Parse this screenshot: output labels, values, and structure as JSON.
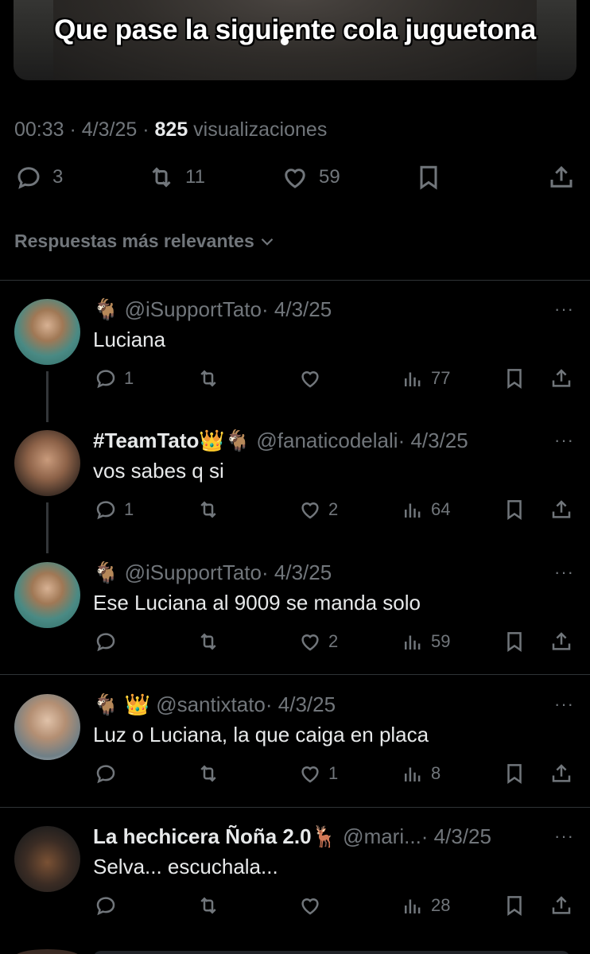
{
  "media": {
    "caption": "Que pase la siguiente cola juguetona"
  },
  "tweet_meta": {
    "time": "00:33",
    "sep1": " · ",
    "date": "4/3/25",
    "sep2": " · ",
    "views_count": "825",
    "views_label": " visualizaciones"
  },
  "tweet_actions": {
    "replies": "3",
    "retweets": "11",
    "likes": "59"
  },
  "sort_label": "Respuestas más relevantes",
  "replies": [
    {
      "emoji": "🐐",
      "name": "",
      "handle": "@iSupportTato",
      "date": "· 4/3/25",
      "text": "Luciana",
      "replies": "1",
      "retweets": "",
      "likes": "",
      "views": "77"
    },
    {
      "emoji": "👑🐐",
      "name": "#TeamTato",
      "handle": "@fanaticodelali",
      "date": "· 4/3/25",
      "text": "vos sabes q si",
      "replies": "1",
      "retweets": "",
      "likes": "2",
      "views": "64"
    },
    {
      "emoji": "🐐",
      "name": "",
      "handle": "@iSupportTato",
      "date": "· 4/3/25",
      "text": "Ese Luciana al 9009 se manda solo",
      "replies": "",
      "retweets": "",
      "likes": "2",
      "views": "59"
    },
    {
      "emoji": "🐐 👑",
      "name": "",
      "handle": "@santixtato",
      "date": "· 4/3/25",
      "text": "Luz o Luciana, la que caiga en placa",
      "replies": "",
      "retweets": "",
      "likes": "1",
      "views": "8"
    },
    {
      "emoji": "🦌",
      "name": "La hechicera Ñoña 2.0",
      "handle": "@mari...",
      "date": "· 4/3/25",
      "text": "Selva... escuchala...",
      "replies": "",
      "retweets": "",
      "likes": "",
      "views": "28"
    }
  ],
  "more_label": "···",
  "icons": [
    "reply-icon",
    "retweet-icon",
    "like-icon",
    "bookmark-icon",
    "share-icon",
    "views-icon",
    "chevron-down-icon",
    "more-icon"
  ]
}
